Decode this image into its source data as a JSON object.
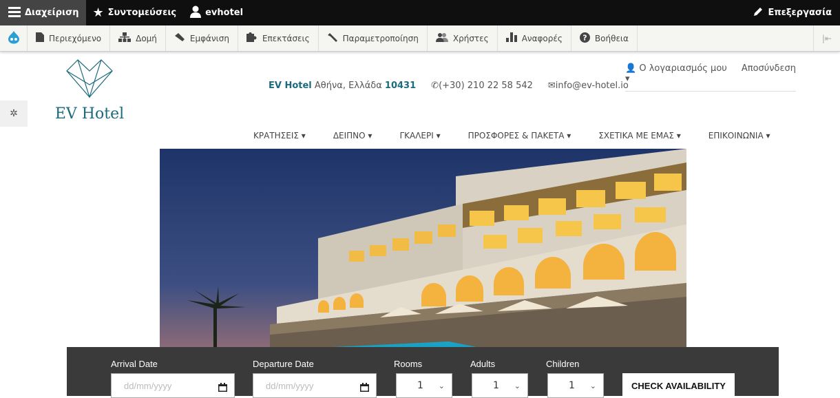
{
  "admin_bar": {
    "manage_label": "Διαχείριση",
    "shortcuts_label": "Συντομεύσεις",
    "user_label": "evhotel",
    "edit_label": "Επεξεργασία"
  },
  "tool_tray": {
    "items": [
      {
        "label": "Περιεχόμενο",
        "icon": "file-icon"
      },
      {
        "label": "Δομή",
        "icon": "sitemap-icon"
      },
      {
        "label": "Εμφάνιση",
        "icon": "brush-icon"
      },
      {
        "label": "Επεκτάσεις",
        "icon": "puzzle-icon"
      },
      {
        "label": "Παραμετροποίηση",
        "icon": "wrench-icon"
      },
      {
        "label": "Χρήστες",
        "icon": "users-icon"
      },
      {
        "label": "Αναφορές",
        "icon": "bar-chart-icon"
      },
      {
        "label": "Βοήθεια",
        "icon": "help-icon"
      }
    ]
  },
  "header": {
    "logo_text": "EV Hotel",
    "brand": "EV Hotel",
    "address": "Αθήνα, Ελλάδα",
    "zip": "10431",
    "phone": "(+30) 210 22 58 542",
    "email": "info@ev-hotel.io",
    "account_label": "Ο λογαριασμός μου",
    "logout_label": "Αποσύνδεση"
  },
  "nav": {
    "items": [
      {
        "label": "ΚΡΑΤΗΣΕΙΣ"
      },
      {
        "label": "ΔΕΙΠΝΟ"
      },
      {
        "label": "ΓΚΑΛΕΡΙ"
      },
      {
        "label": "ΠΡΟΣΦΟΡΕΣ & ΠΑΚΕΤΑ"
      },
      {
        "label": "ΣΧΕΤΙΚΑ ΜΕ ΕΜΑΣ"
      },
      {
        "label": "ΕΠΙΚΟΙΝΩΝΙΑ"
      }
    ]
  },
  "booking": {
    "arrival_label": "Arrival Date",
    "arrival_placeholder": "dd/mm/yyyy",
    "departure_label": "Departure Date",
    "departure_placeholder": "dd/mm/yyyy",
    "rooms_label": "Rooms",
    "rooms_value": "1",
    "adults_label": "Adults",
    "adults_value": "1",
    "children_label": "Children",
    "children_value": "1",
    "check_label": "CHECK AVAILABILITY"
  },
  "colors": {
    "admin_bar": "#0f0f0f",
    "brand_teal": "#1b6a7d",
    "booking_bar": "#3a3a3a"
  }
}
